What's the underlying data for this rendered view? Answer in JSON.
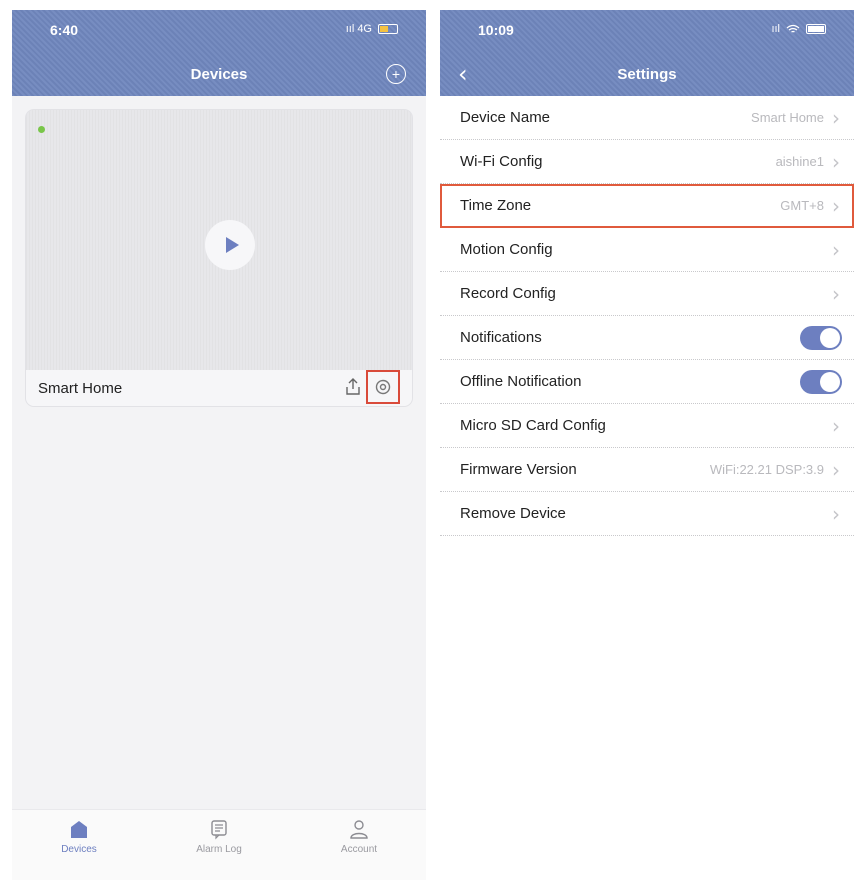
{
  "left": {
    "status": {
      "time": "6:40",
      "signal": "ııl 4G"
    },
    "title": "Devices",
    "card": {
      "status_text": "",
      "device_name": "Smart Home"
    },
    "tabs": [
      {
        "label": "Devices",
        "icon": "devices-icon",
        "active": true
      },
      {
        "label": "Alarm Log",
        "icon": "alarm-log-icon",
        "active": false
      },
      {
        "label": "Account",
        "icon": "account-icon",
        "active": false
      }
    ]
  },
  "right": {
    "status": {
      "time": "10:09",
      "signal": "ııl"
    },
    "title": "Settings",
    "rows": [
      {
        "label": "Device Name",
        "value": "Smart Home",
        "type": "chevron"
      },
      {
        "label": "Wi-Fi Config",
        "value": "aishine1",
        "type": "chevron"
      },
      {
        "label": "Time Zone",
        "value": "GMT+8",
        "type": "chevron",
        "highlighted": true
      },
      {
        "label": "Motion Config",
        "value": "",
        "type": "chevron"
      },
      {
        "label": "Record Config",
        "value": "",
        "type": "chevron"
      },
      {
        "label": "Notifications",
        "value": "",
        "type": "toggle",
        "on": true
      },
      {
        "label": "Offline Notification",
        "value": "",
        "type": "toggle",
        "on": true
      },
      {
        "label": "Micro SD Card Config",
        "value": "",
        "type": "chevron"
      },
      {
        "label": "Firmware Version",
        "value": "WiFi:22.21 DSP:3.9",
        "type": "chevron"
      },
      {
        "label": "Remove Device",
        "value": "",
        "type": "chevron"
      }
    ]
  },
  "colors": {
    "accent": "#6d7fc0",
    "nav_bar": "#6f86bd",
    "highlight": "#e05a3c"
  }
}
